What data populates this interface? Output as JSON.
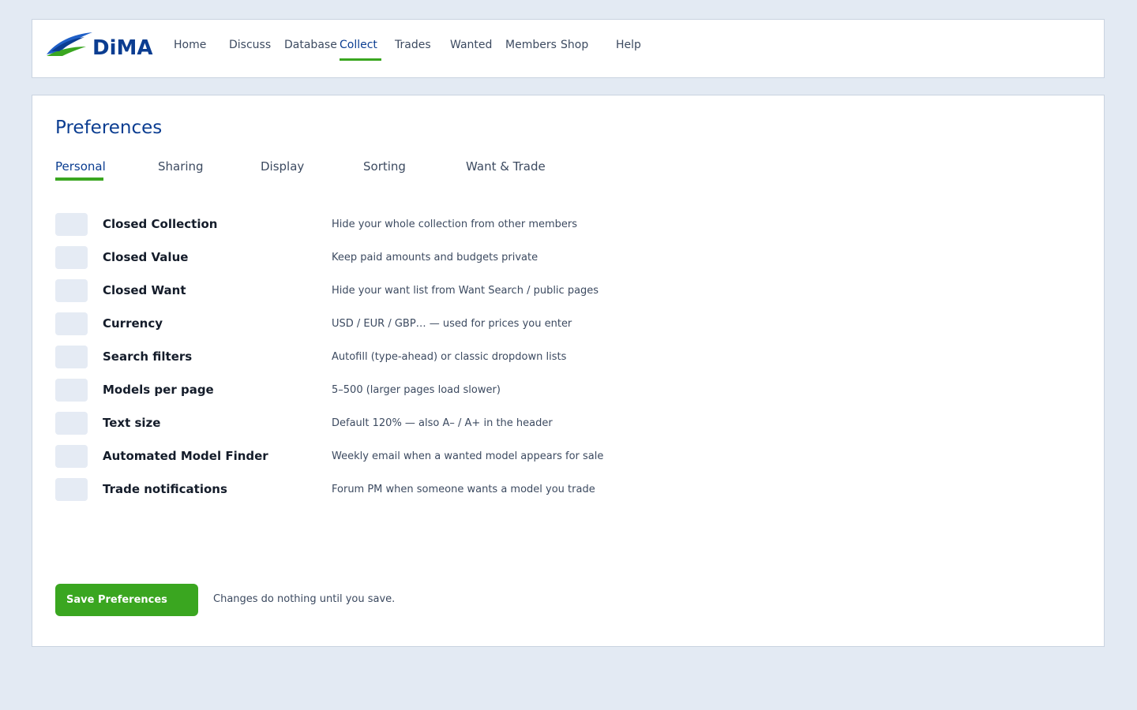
{
  "brand": {
    "name": "DiMA",
    "primary_color": "#0b3d91",
    "accent_color": "#3aa620"
  },
  "nav": {
    "items": [
      {
        "label": "Home"
      },
      {
        "label": "Discuss"
      },
      {
        "label": "Database"
      },
      {
        "label": "Collect",
        "active": true
      },
      {
        "label": "Trades"
      },
      {
        "label": "Wanted"
      },
      {
        "label": "Members"
      },
      {
        "label": "Shop"
      },
      {
        "label": "Help"
      }
    ]
  },
  "page": {
    "title": "Preferences",
    "tabs": [
      {
        "label": "Personal",
        "active": true
      },
      {
        "label": "Sharing"
      },
      {
        "label": "Display"
      },
      {
        "label": "Sorting"
      },
      {
        "label": "Want & Trade"
      }
    ]
  },
  "preferences": [
    {
      "label": "Closed Collection",
      "description": "Hide your whole collection from other members"
    },
    {
      "label": "Closed Value",
      "description": "Keep paid amounts and budgets private"
    },
    {
      "label": "Closed Want",
      "description": "Hide your want list from Want Search / public pages"
    },
    {
      "label": "Currency",
      "description": "USD / EUR / GBP… — used for prices you enter"
    },
    {
      "label": "Search filters",
      "description": "Autofill (type-ahead) or classic dropdown lists"
    },
    {
      "label": "Models per page",
      "description": "5–500 (larger pages load slower)"
    },
    {
      "label": "Text size",
      "description": "Default 120% — also A– / A+ in the header"
    },
    {
      "label": "Automated Model Finder",
      "description": "Weekly email when a wanted model appears for sale"
    },
    {
      "label": "Trade notifications",
      "description": "Forum PM when someone wants a model you trade"
    }
  ],
  "actions": {
    "save_label": "Save Preferences",
    "save_note": "Changes do nothing until you save."
  }
}
